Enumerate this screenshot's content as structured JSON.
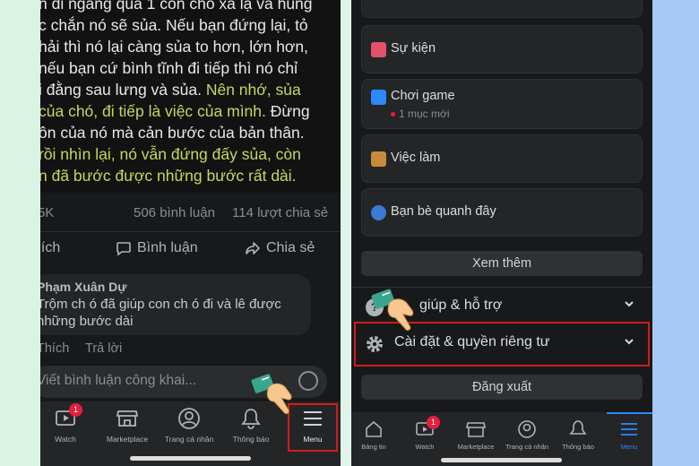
{
  "left_screen": {
    "post_lines": [
      {
        "parts": [
          {
            "t": "n đi ngang qua 1 con chó xa lạ và hung",
            "c": "w"
          }
        ]
      },
      {
        "parts": [
          {
            "t": "c chắn nó sẽ sủa. Nếu bạn đứng lại, tỏ",
            "c": "w"
          }
        ]
      },
      {
        "parts": [
          {
            "t": "hải thì nó lại càng sủa to hơn, lớn hơn,",
            "c": "w"
          }
        ]
      },
      {
        "parts": [
          {
            "t": "nếu bạn cứ bình tĩnh đi tiếp thì nó chỉ",
            "c": "w"
          }
        ]
      },
      {
        "parts": [
          {
            "t": "i đằng sau lưng và sủa. ",
            "c": "w"
          },
          {
            "t": "Nên nhớ, sủa",
            "c": "g"
          }
        ]
      },
      {
        "parts": [
          {
            "t": "của chó, đi tiếp là việc của mình. ",
            "c": "g"
          },
          {
            "t": "Đừng",
            "c": "w"
          }
        ]
      },
      {
        "parts": [
          {
            "t": "ôn của nó mà cản bước của bản thân.",
            "c": "w"
          }
        ]
      },
      {
        "parts": [
          {
            "t": "rồi nhìn lại, nó vẫn đứng đấy sủa, còn",
            "c": "g"
          }
        ]
      },
      {
        "parts": [
          {
            "t": "n đã bước được những bước rất dài.",
            "c": "g"
          }
        ]
      }
    ],
    "stats": {
      "reactions": "5K",
      "comments": "506 bình luận",
      "shares": "114 lượt chia sẻ"
    },
    "actions": {
      "like": "hích",
      "comment": "Bình luận",
      "share": "Chia sẻ"
    },
    "comment": {
      "author": "Phạm Xuân Dự",
      "text_line1": "Trộm ch ó đã giúp con ch ó đi và lê được",
      "text_line2": "những bước dài",
      "like": "Thích",
      "reply": "Trả lời"
    },
    "write_placeholder": "Viết bình luận công khai...",
    "nav": {
      "watch": "Watch",
      "watch_badge": "1",
      "marketplace": "Marketplace",
      "profile": "Trang cá nhân",
      "notifications": "Thông báo",
      "menu": "Menu"
    }
  },
  "right_screen": {
    "items": [
      {
        "label": "Sự kiện",
        "icon": "calendar-icon",
        "color": "#e4526a"
      },
      {
        "label": "Chơi game",
        "sub": "1 mục mới",
        "icon": "game-icon",
        "color": "#2d88ff"
      },
      {
        "label": "Việc làm",
        "icon": "briefcase-icon",
        "color": "#c98a3a"
      },
      {
        "label": "Bạn bè quanh đây",
        "icon": "nearby-friends-icon",
        "color": "#3b7ad9"
      }
    ],
    "see_more": "Xem thêm",
    "help": "Trợ giúp & hỗ trợ",
    "help_visible": "giúp & hỗ trợ",
    "settings": "Cài đặt & quyền riêng tư",
    "logout": "Đăng xuất",
    "nav": {
      "news": "Bảng tin",
      "watch": "Watch",
      "watch_badge": "1",
      "marketplace": "Marketplace",
      "profile": "Trang cá nhân",
      "notifications": "Thông báo",
      "menu": "Menu"
    }
  },
  "colors": {
    "highlight": "#d11b1b",
    "accent_blue": "#2d88ff",
    "green_text": "#c6d85a",
    "badge": "#e41e3f"
  }
}
